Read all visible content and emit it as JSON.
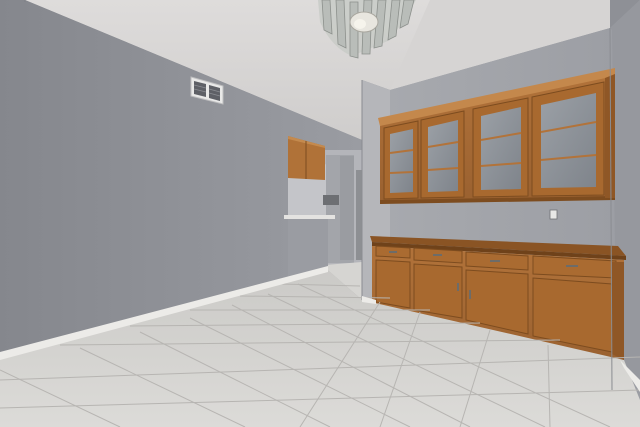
{
  "scene": {
    "subject": "empty-dining-room",
    "palette": {
      "ceiling": "#d9d7d6",
      "wall_left": "#8e9096",
      "wall_right": "#a0a2a8",
      "wall_back": "#b2b3b8",
      "floor": "#d3d2d0",
      "grout": "#b9b7b4",
      "cabinet_wood": "#a86c34",
      "cabinet_wood_dark": "#7d4c1f",
      "cabinet_trim": "#c4884c",
      "glass": "#8f949a",
      "baseboard": "#ecebe8",
      "chandelier": "#c9ccc8"
    },
    "features": [
      "textured-ceiling",
      "crystal-chandelier",
      "air-vent",
      "upper-glass-door-cabinets",
      "lower-base-cabinets",
      "kitchen-pass-through",
      "tile-floor",
      "baseboard-trim"
    ]
  }
}
